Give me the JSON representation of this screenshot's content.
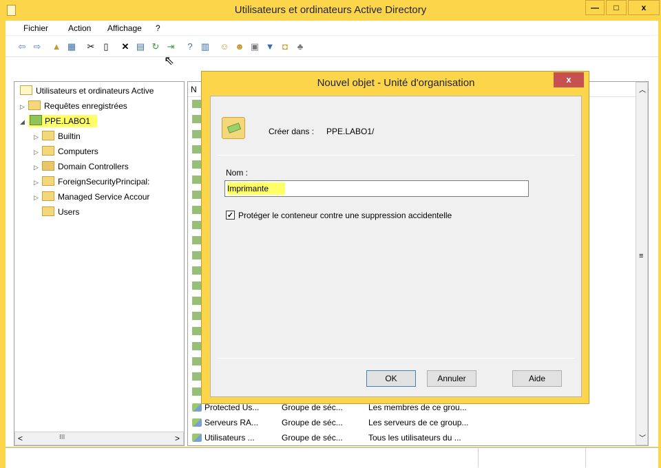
{
  "window": {
    "title": "Utilisateurs et ordinateurs Active Directory",
    "min": "—",
    "max": "□",
    "close": "x"
  },
  "menu": [
    "Fichier",
    "Action",
    "Affichage",
    "?"
  ],
  "tree": {
    "root": "Utilisateurs et ordinateurs Active",
    "saved_queries": "Requêtes enregistrées",
    "domain": "PPE.LABO1",
    "children": [
      "Builtin",
      "Computers",
      "Domain Controllers",
      "ForeignSecurityPrincipal:",
      "Managed Service Accour",
      "Users"
    ],
    "scroll_left": "<",
    "scroll_right": ">",
    "scroll_thumb": "III"
  },
  "list": {
    "header_first": "N",
    "rows": [
      {
        "name": "Protected Us...",
        "type": "Groupe de séc...",
        "description": "Les membres de ce grou..."
      },
      {
        "name": "Serveurs RA...",
        "type": "Groupe de séc...",
        "description": "Les serveurs de ce group..."
      },
      {
        "name": "Utilisateurs ...",
        "type": "Groupe de séc...",
        "description": "Tous les utilisateurs du ..."
      }
    ]
  },
  "dialog": {
    "title": "Nouvel objet - Unité d'organisation",
    "close": "x",
    "create_in_label": "Créer dans :",
    "create_in_value": "PPE.LABO1/",
    "name_label": "Nom :",
    "name_value": "Imprimante",
    "protect_label": "Protéger le conteneur contre une suppression accidentelle",
    "protect_checked": true,
    "ok": "OK",
    "cancel": "Annuler",
    "help": "Aide"
  }
}
